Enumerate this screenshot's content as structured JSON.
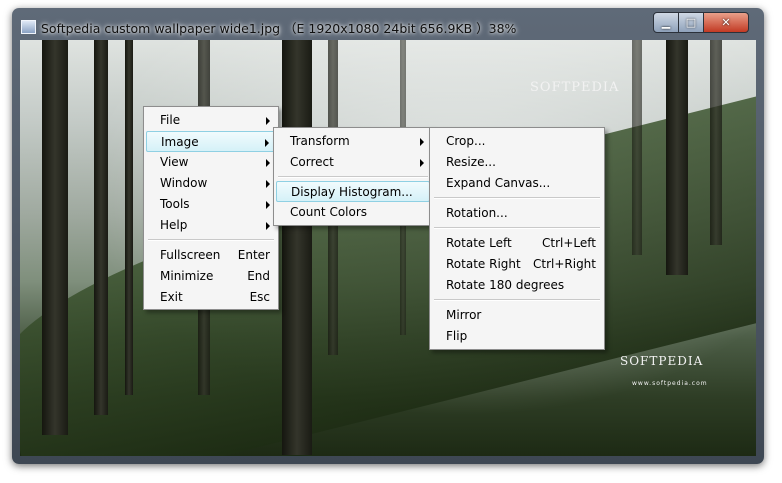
{
  "window": {
    "title": "Softpedia custom wallpaper wide1.jpg （E  1920x1080  24bit  656.9KB ）38%",
    "caption_buttons": {
      "minimize_icon": "minimize-icon",
      "maximize_icon": "maximize-icon",
      "close_icon": "close-icon"
    }
  },
  "watermark": {
    "top_text": "SOFTPEDIA",
    "bottom_text": "SOFTPEDIA",
    "bottom_sub": "www.softpedia.com"
  },
  "main_menu": {
    "items": [
      {
        "label": "File",
        "submenu": true
      },
      {
        "label": "Image",
        "submenu": true
      },
      {
        "label": "View",
        "submenu": true
      },
      {
        "label": "Window",
        "submenu": true
      },
      {
        "label": "Tools",
        "submenu": true
      },
      {
        "label": "Help",
        "submenu": true
      },
      {
        "label": "Fullscreen",
        "shortcut": "Enter"
      },
      {
        "label": "Minimize",
        "shortcut": "End"
      },
      {
        "label": "Exit",
        "shortcut": "Esc"
      }
    ]
  },
  "image_menu": {
    "items": [
      {
        "label": "Transform",
        "submenu": true
      },
      {
        "label": "Correct",
        "submenu": true
      },
      {
        "label": "Display Histogram..."
      },
      {
        "label": "Count Colors"
      }
    ]
  },
  "transform_menu": {
    "items": [
      {
        "label": "Crop..."
      },
      {
        "label": "Resize..."
      },
      {
        "label": "Expand Canvas..."
      },
      {
        "label": "Rotation..."
      },
      {
        "label": "Rotate Left",
        "shortcut": "Ctrl+Left"
      },
      {
        "label": "Rotate Right",
        "shortcut": "Ctrl+Right"
      },
      {
        "label": "Rotate 180 degrees"
      },
      {
        "label": "Mirror"
      },
      {
        "label": "Flip"
      }
    ]
  },
  "colors": {
    "highlight_border": "#8fd0e3",
    "highlight_fill": "#d5f1f8",
    "menu_bg": "#f5f5f5"
  }
}
